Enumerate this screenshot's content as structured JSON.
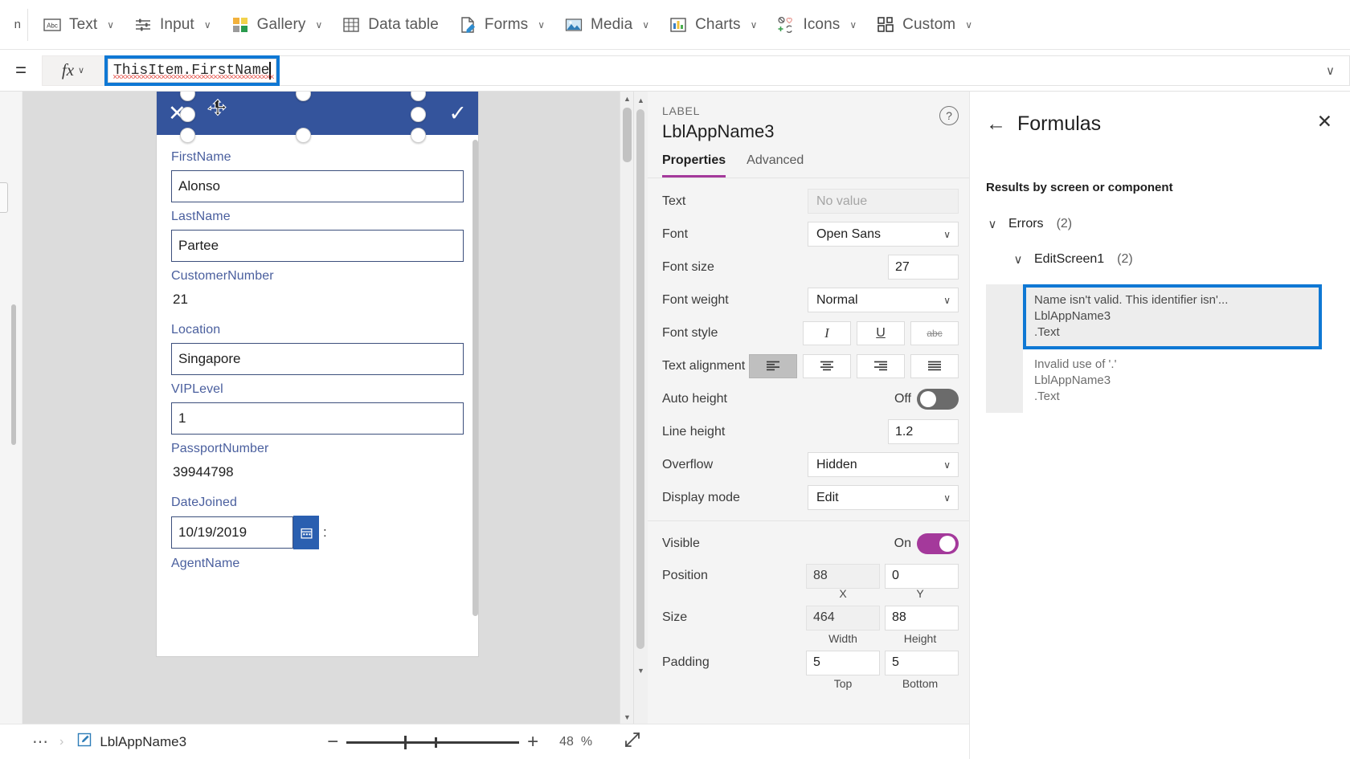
{
  "ribbon": {
    "items": [
      {
        "label": "Text",
        "icon": "text-icon",
        "chevron": "∨"
      },
      {
        "label": "Input",
        "icon": "input-icon",
        "chevron": "∨"
      },
      {
        "label": "Gallery",
        "icon": "gallery-icon",
        "chevron": "∨"
      },
      {
        "label": "Data table",
        "icon": "data-table-icon",
        "chevron": ""
      },
      {
        "label": "Forms",
        "icon": "forms-icon",
        "chevron": "∨"
      },
      {
        "label": "Media",
        "icon": "media-icon",
        "chevron": "∨"
      },
      {
        "label": "Charts",
        "icon": "charts-icon",
        "chevron": "∨"
      },
      {
        "label": "Icons",
        "icon": "icons-icon",
        "chevron": "∨"
      },
      {
        "label": "Custom",
        "icon": "custom-icon",
        "chevron": "∨"
      }
    ]
  },
  "formula_bar": {
    "equals": "=",
    "fx_symbol": "fx",
    "fx_chevron": "∨",
    "value": "ThisItem.FirstName",
    "expand_chevron": "∨",
    "has_error_underline": true,
    "focus_color": "#0f78d4"
  },
  "canvas": {
    "form_header": {
      "cancel_icon": "✕",
      "confirm_icon": "✓",
      "background": "#34549c"
    },
    "fields": [
      {
        "label": "FirstName",
        "value": "Alonso",
        "type": "input"
      },
      {
        "label": "LastName",
        "value": "Partee",
        "type": "input"
      },
      {
        "label": "CustomerNumber",
        "value": "21",
        "type": "text"
      },
      {
        "label": "Location",
        "value": "Singapore",
        "type": "input"
      },
      {
        "label": "VIPLevel",
        "value": "1",
        "type": "input"
      },
      {
        "label": "PassportNumber",
        "value": "39944798",
        "type": "text"
      },
      {
        "label": "DateJoined",
        "value": "10/19/2019",
        "type": "date"
      },
      {
        "label": "AgentName",
        "value": "",
        "type": "label-only"
      }
    ],
    "date_suffix": ":"
  },
  "properties": {
    "kind": "LABEL",
    "control_name": "LblAppName3",
    "help_icon": "?",
    "tabs": [
      {
        "label": "Properties",
        "active": true
      },
      {
        "label": "Advanced",
        "active": false
      }
    ],
    "accent": "#a4399b",
    "rows": [
      {
        "label": "Text",
        "type": "select",
        "value": "No value",
        "disabled": true
      },
      {
        "label": "Font",
        "type": "select",
        "value": "Open Sans"
      },
      {
        "label": "Font size",
        "type": "number",
        "value": "27"
      },
      {
        "label": "Font weight",
        "type": "select",
        "value": "Normal"
      },
      {
        "label": "Font style",
        "type": "buttons",
        "buttons": [
          {
            "name": "italic-button",
            "glyph": "I",
            "active": false
          },
          {
            "name": "underline-button",
            "glyph": "U",
            "active": false
          },
          {
            "name": "strikethrough-button",
            "glyph": "abc",
            "active": false
          }
        ]
      },
      {
        "label": "Text alignment",
        "type": "align",
        "buttons": [
          {
            "name": "align-left-button",
            "active": true
          },
          {
            "name": "align-center-button",
            "active": false
          },
          {
            "name": "align-right-button",
            "active": false
          },
          {
            "name": "align-justify-button",
            "active": false
          }
        ]
      },
      {
        "label": "Auto height",
        "type": "toggle",
        "state_text": "Off",
        "on": false
      },
      {
        "label": "Line height",
        "type": "number",
        "value": "1.2"
      },
      {
        "label": "Overflow",
        "type": "select",
        "value": "Hidden"
      },
      {
        "label": "Display mode",
        "type": "select",
        "value": "Edit"
      }
    ],
    "rows2": [
      {
        "label": "Visible",
        "type": "toggle",
        "state_text": "On",
        "on": true
      },
      {
        "label": "Position",
        "type": "pair",
        "v1": "88",
        "v2": "0",
        "s1": "X",
        "s2": "Y",
        "grey1": true,
        "grey2": false
      },
      {
        "label": "Size",
        "type": "pair",
        "v1": "464",
        "v2": "88",
        "s1": "Width",
        "s2": "Height",
        "grey1": true,
        "grey2": false
      },
      {
        "label": "Padding",
        "type": "pair",
        "v1": "5",
        "v2": "5",
        "s1": "Top",
        "s2": "Bottom",
        "grey1": false,
        "grey2": false
      }
    ]
  },
  "formulas_panel": {
    "back_icon": "←",
    "title": "Formulas",
    "close_icon": "✕",
    "subtitle": "Results by screen or component",
    "tree": {
      "expand_glyph": "∨",
      "root_label": "Errors",
      "root_count": "(2)",
      "screen_label": "EditScreen1",
      "screen_count": "(2)"
    },
    "errors": [
      {
        "message": "Name isn't valid. This identifier isn'...",
        "control": "LblAppName3",
        "property": ".Text",
        "selected": true
      },
      {
        "message": "Invalid use of '.'",
        "control": "LblAppName3",
        "property": ".Text",
        "selected": false
      }
    ],
    "selection_color": "#0f78d4"
  },
  "status_bar": {
    "more_icon": "⋯",
    "breadcrumb_chevron": "›",
    "selected_control": "LblAppName3",
    "control_icon": "edit-label-icon",
    "zoom_out": "−",
    "zoom_in": "+",
    "zoom_value": "48",
    "zoom_unit": "%",
    "fit_icon": "fit-to-screen-icon"
  }
}
